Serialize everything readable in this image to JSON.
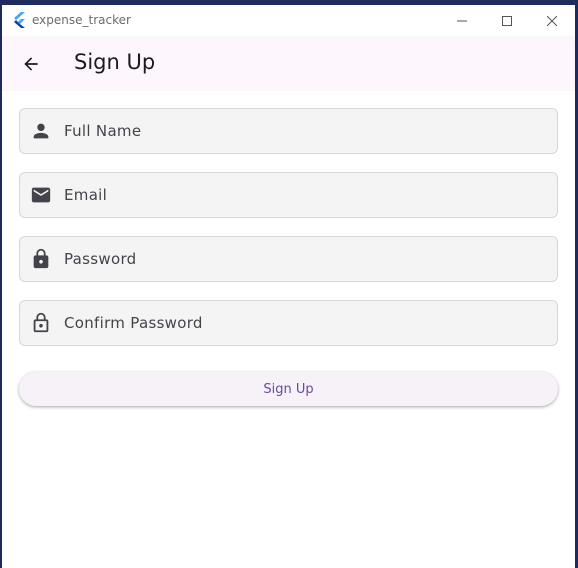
{
  "window": {
    "title": "expense_tracker",
    "logo_icon": "flutter-logo"
  },
  "appbar": {
    "back_icon": "arrow-back-icon",
    "title": "Sign Up",
    "background": "#fdf6fd"
  },
  "form": {
    "fields": [
      {
        "icon": "person-icon",
        "placeholder": "Full Name"
      },
      {
        "icon": "mail-icon",
        "placeholder": "Email"
      },
      {
        "icon": "lock-icon",
        "placeholder": "Password"
      },
      {
        "icon": "lock-outline-icon",
        "placeholder": "Confirm Password"
      }
    ],
    "submit_label": "Sign Up",
    "accent": "#6a4ba3"
  }
}
